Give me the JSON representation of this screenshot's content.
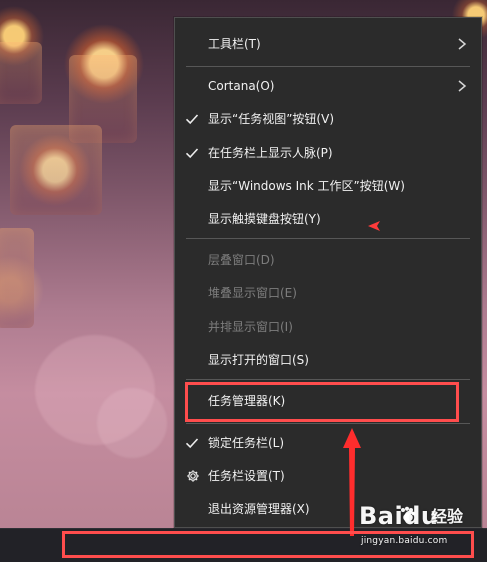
{
  "context_menu": {
    "items": [
      {
        "label": "工具栏(T)",
        "submenu": true,
        "checked": false,
        "disabled": false,
        "icon": ""
      },
      {
        "label": "Cortana(O)",
        "submenu": true,
        "checked": false,
        "disabled": false,
        "icon": ""
      },
      {
        "label": "显示“任务视图”按钮(V)",
        "submenu": false,
        "checked": true,
        "disabled": false,
        "icon": "check-icon"
      },
      {
        "label": "在任务栏上显示人脉(P)",
        "submenu": false,
        "checked": true,
        "disabled": false,
        "icon": "check-icon"
      },
      {
        "label": "显示“Windows Ink 工作区”按钮(W)",
        "submenu": false,
        "checked": false,
        "disabled": false,
        "icon": ""
      },
      {
        "label": "显示触摸键盘按钮(Y)",
        "submenu": false,
        "checked": false,
        "disabled": false,
        "icon": ""
      },
      {
        "label": "层叠窗口(D)",
        "submenu": false,
        "checked": false,
        "disabled": true,
        "icon": ""
      },
      {
        "label": "堆叠显示窗口(E)",
        "submenu": false,
        "checked": false,
        "disabled": true,
        "icon": ""
      },
      {
        "label": "并排显示窗口(I)",
        "submenu": false,
        "checked": false,
        "disabled": true,
        "icon": ""
      },
      {
        "label": "显示打开的窗口(S)",
        "submenu": false,
        "checked": false,
        "disabled": false,
        "icon": ""
      },
      {
        "label": "任务管理器(K)",
        "submenu": false,
        "checked": false,
        "disabled": false,
        "icon": ""
      },
      {
        "label": "锁定任务栏(L)",
        "submenu": false,
        "checked": true,
        "disabled": false,
        "icon": "check-icon"
      },
      {
        "label": "任务栏设置(T)",
        "submenu": false,
        "checked": false,
        "disabled": false,
        "icon": "gear-icon"
      },
      {
        "label": "退出资源管理器(X)",
        "submenu": false,
        "checked": false,
        "disabled": false,
        "icon": ""
      }
    ]
  },
  "watermark": {
    "brand": "Bai",
    "brand_suffix": "du",
    "section": "经验",
    "subtext": "jingyan.baidu.com"
  },
  "colors": {
    "menu_background": "#2b2b2b",
    "menu_text": "#f2f2f2",
    "disabled_text": "#7d7d7d",
    "highlight_red": "#ff4d4d",
    "taskbar": "#222227"
  },
  "icons": {
    "submenu": "chevron-right-icon",
    "checked": "check-icon",
    "settings": "gear-icon"
  }
}
